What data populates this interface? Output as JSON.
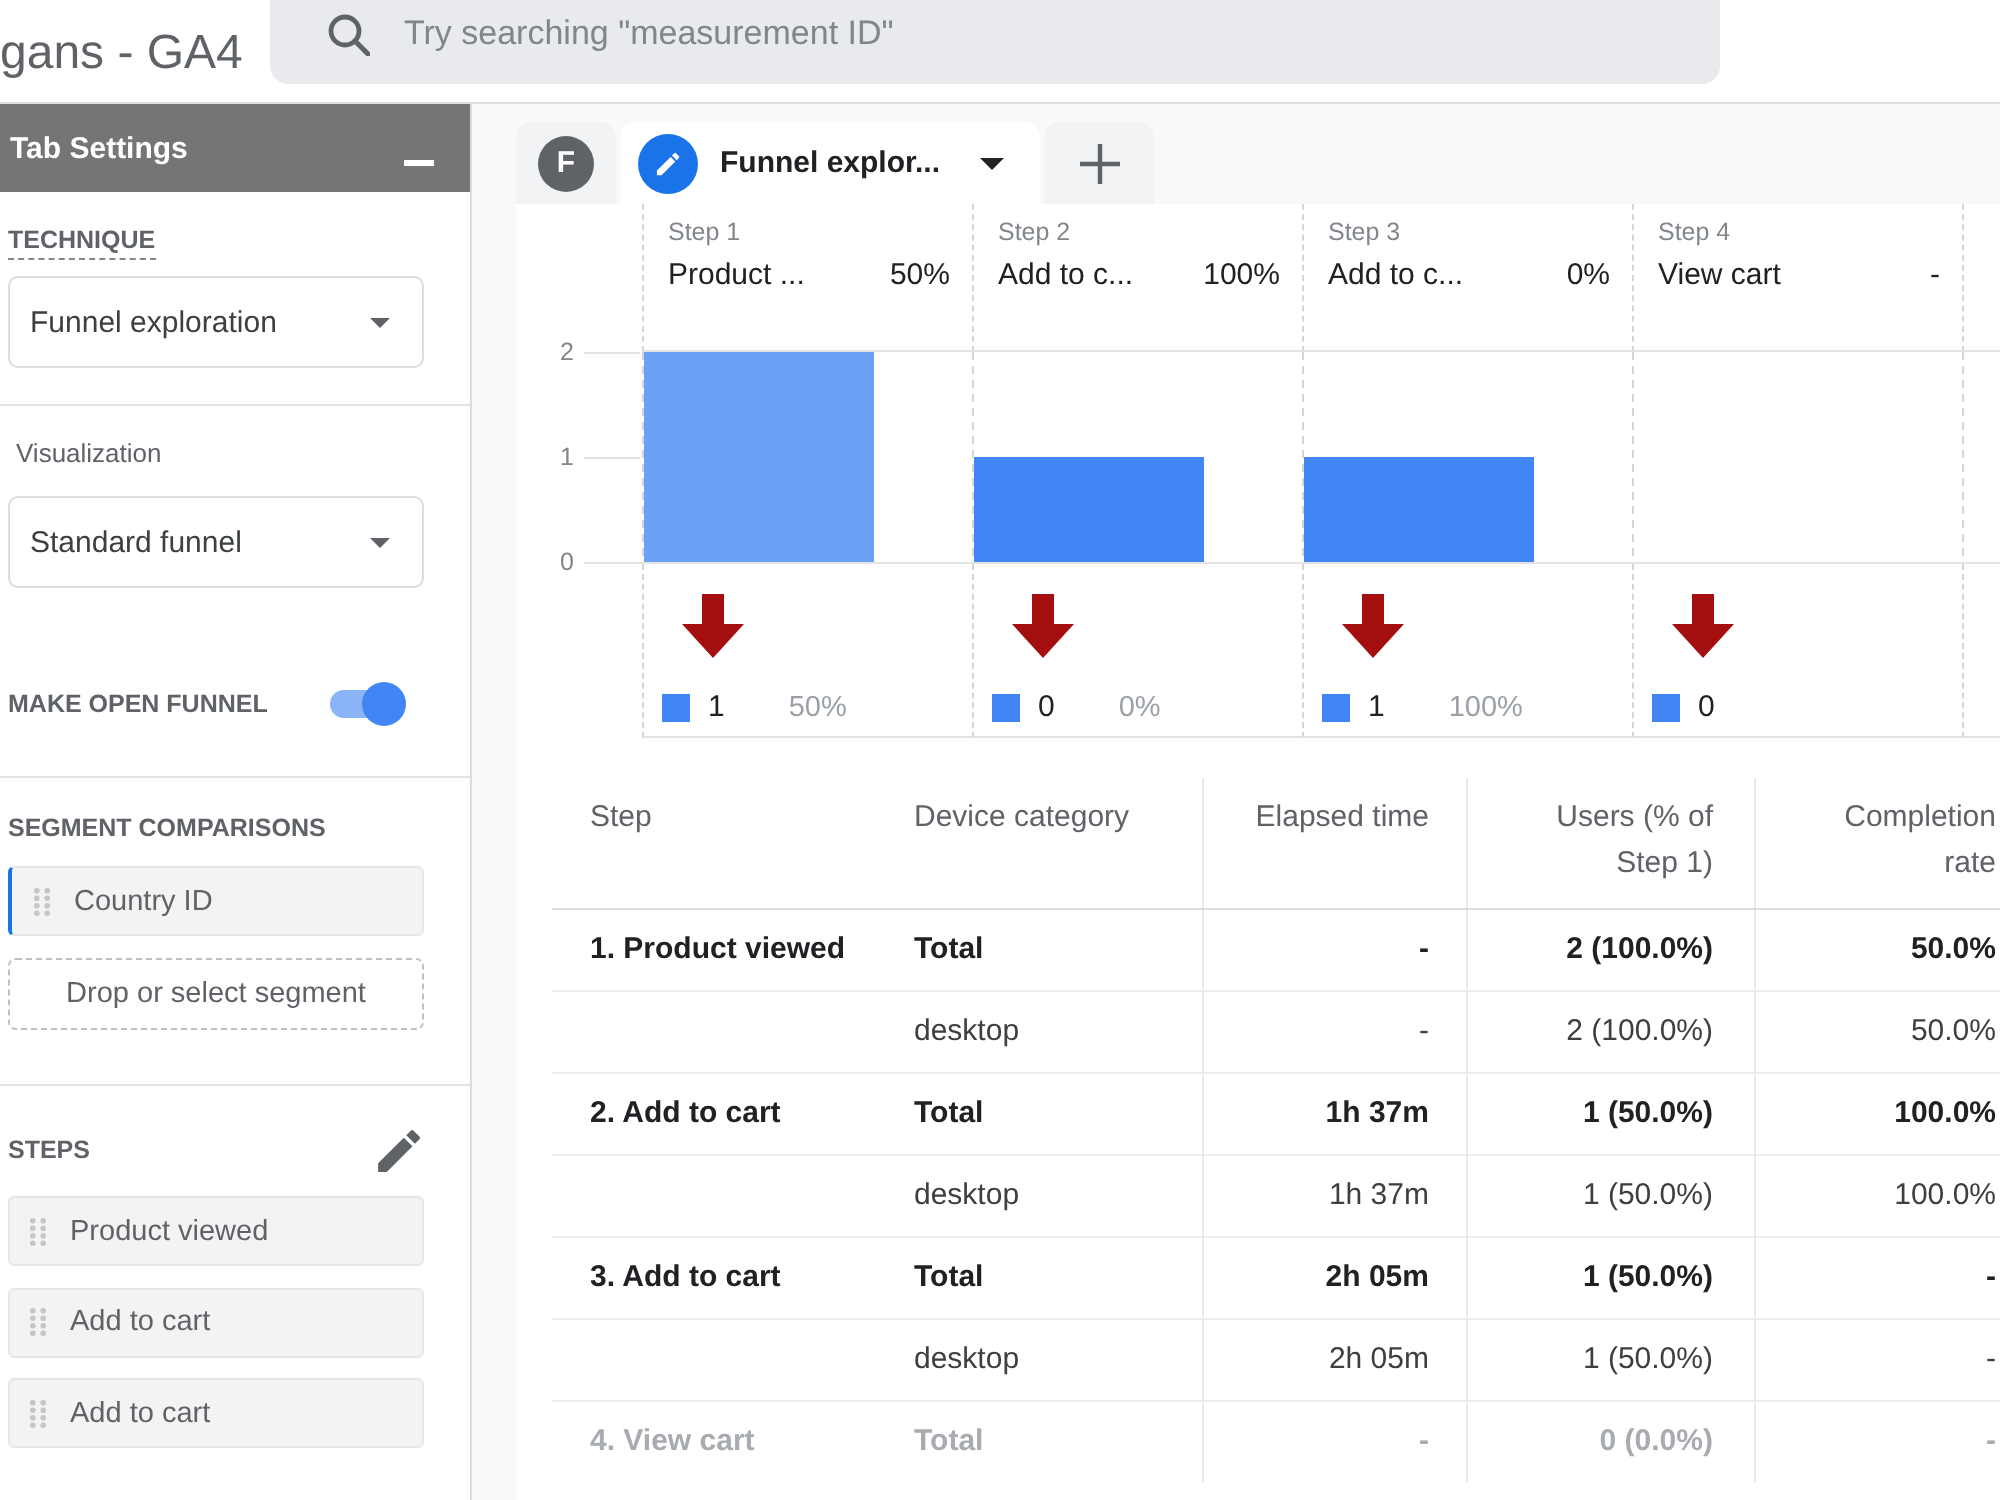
{
  "header": {
    "property_name": "gans - GA4",
    "search": {
      "placeholder": "Try searching \"measurement ID\""
    }
  },
  "settings_panel": {
    "title": "Tab Settings",
    "technique": {
      "label": "TECHNIQUE",
      "value": "Funnel exploration"
    },
    "visualization": {
      "label": "Visualization",
      "value": "Standard funnel"
    },
    "open_funnel": {
      "label": "MAKE OPEN FUNNEL",
      "on": true
    },
    "segment_comparisons": {
      "label": "SEGMENT COMPARISONS",
      "segments": [
        {
          "label": "Country ID"
        }
      ],
      "drop_zone": "Drop or select segment"
    },
    "steps": {
      "label": "STEPS",
      "items": [
        {
          "label": "Product viewed"
        },
        {
          "label": "Add to cart"
        },
        {
          "label": "Add to cart"
        }
      ]
    }
  },
  "tabs": [
    {
      "kind": "letter",
      "label": "F",
      "selected": false
    },
    {
      "kind": "technique",
      "label": "Funnel explor...",
      "selected": true
    },
    {
      "kind": "add",
      "selected": false
    }
  ],
  "funnel_chart": {
    "steps": [
      {
        "step": "Step 1",
        "name": "Product ...",
        "completion_rate": "50%",
        "color": "#6aa1f6",
        "abandon_count": "1",
        "abandon_rate": "50%"
      },
      {
        "step": "Step 2",
        "name": "Add to c...",
        "completion_rate": "100%",
        "color": "#4285f4",
        "abandon_count": "0",
        "abandon_rate": "0%"
      },
      {
        "step": "Step 3",
        "name": "Add to c...",
        "completion_rate": "0%",
        "color": "#4285f4",
        "abandon_count": "1",
        "abandon_rate": "100%"
      },
      {
        "step": "Step 4",
        "name": "View cart",
        "completion_rate": "-",
        "abandon_count": "0"
      }
    ],
    "chart_data": {
      "type": "bar",
      "values": [
        2,
        1,
        1,
        0
      ],
      "ylim": [
        0,
        2
      ],
      "yticks": [
        0,
        1,
        2
      ]
    }
  },
  "table": {
    "columns": [
      "Step",
      "Device category",
      "Elapsed time",
      "Users (% of Step 1)",
      "Completion rate"
    ],
    "rows": [
      {
        "kind": "total",
        "step": "1. Product viewed",
        "device": "Total",
        "elapsed_time": "-",
        "users": "2 (100.0%)",
        "completion_rate": "50.0%",
        "dimmed": false
      },
      {
        "kind": "device",
        "device": "desktop",
        "elapsed_time": "-",
        "users": "2 (100.0%)",
        "completion_rate": "50.0%",
        "dimmed": false
      },
      {
        "kind": "total",
        "step": "2. Add to cart",
        "device": "Total",
        "elapsed_time": "1h 37m",
        "users": "1 (50.0%)",
        "completion_rate": "100.0%",
        "dimmed": false
      },
      {
        "kind": "device",
        "device": "desktop",
        "elapsed_time": "1h 37m",
        "users": "1 (50.0%)",
        "completion_rate": "100.0%",
        "dimmed": false
      },
      {
        "kind": "total",
        "step": "3. Add to cart",
        "device": "Total",
        "elapsed_time": "2h 05m",
        "users": "1 (50.0%)",
        "completion_rate": "-",
        "dimmed": false
      },
      {
        "kind": "device",
        "device": "desktop",
        "elapsed_time": "2h 05m",
        "users": "1 (50.0%)",
        "completion_rate": "-",
        "dimmed": false
      },
      {
        "kind": "total",
        "step": "4. View cart",
        "device": "Total",
        "elapsed_time": "-",
        "users": "0 (0.0%)",
        "completion_rate": "-",
        "dimmed": true
      }
    ]
  }
}
